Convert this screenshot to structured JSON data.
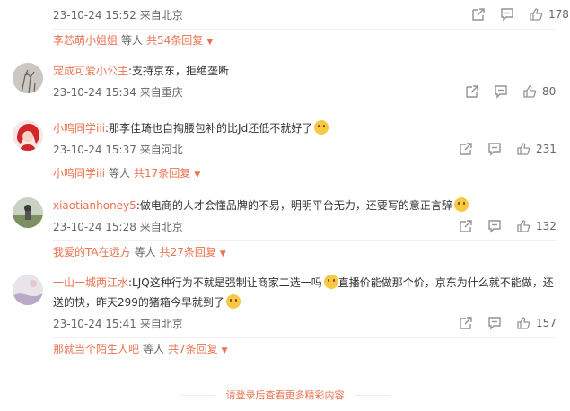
{
  "top_comment": {
    "time": "23-10-24 15:52",
    "source": "来自北京",
    "likes": "178",
    "reply": {
      "name": "李芯萌小姐姐",
      "label": "等人",
      "total": "共54条回复"
    }
  },
  "comments": [
    {
      "user": "宠成可爱小公主",
      "content": ":支持京东，拒绝垄断",
      "time": "23-10-24 15:34",
      "source": "来自重庆",
      "likes": "80"
    },
    {
      "user": "小鸣同学iii",
      "content": ":那李佳琦也自掏腰包补的比Jd还低不就好了",
      "time": "23-10-24 15:37",
      "source": "来自河北",
      "likes": "231",
      "reply": {
        "name": "小鸣同学iii",
        "label": "等人",
        "total": "共17条回复"
      }
    },
    {
      "user": "xiaotianhoney5",
      "content": ":做电商的人才会懂品牌的不易，明明平台无力，还要写的意正言辞",
      "time": "23-10-24 15:28",
      "source": "来自北京",
      "likes": "132",
      "reply": {
        "name": "我爱的TA在远方",
        "label": "等人",
        "total": "共27条回复"
      }
    },
    {
      "user": "一山一城两江水",
      "content_a": ":LJQ这种行为不就是强制让商家二选一吗",
      "content_b": "直播价能做那个价，京东为什么就不能做，还送的快，昨天299的猪箱今早就到了",
      "time": "23-10-24 15:41",
      "source": "来自北京",
      "likes": "157",
      "reply": {
        "name": "那就当个陌生人吧",
        "label": "等人",
        "total": "共7条回复"
      }
    }
  ],
  "footer": {
    "login_more": "请登录后查看更多精彩内容"
  },
  "colors": {
    "accent": "#eb7350",
    "muted": "#939393"
  }
}
